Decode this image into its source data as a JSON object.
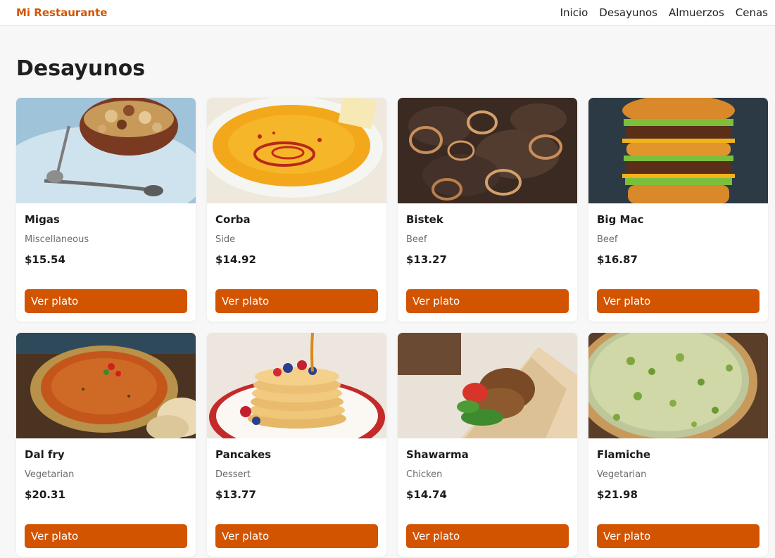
{
  "colors": {
    "accent": "#d35400",
    "background": "#f7f7f7",
    "card": "#ffffff"
  },
  "navbar": {
    "brand": "Mi Restaurante",
    "links": [
      "Inicio",
      "Desayunos",
      "Almuerzos",
      "Cenas"
    ]
  },
  "page_title": "Desayunos",
  "dishes": [
    {
      "name": "Migas",
      "category": "Miscellaneous",
      "price": "$15.54",
      "button": "Ver plato",
      "image": "migas-photo"
    },
    {
      "name": "Corba",
      "category": "Side",
      "price": "$14.92",
      "button": "Ver plato",
      "image": "corba-photo"
    },
    {
      "name": "Bistek",
      "category": "Beef",
      "price": "$13.27",
      "button": "Ver plato",
      "image": "bistek-photo"
    },
    {
      "name": "Big Mac",
      "category": "Beef",
      "price": "$16.87",
      "button": "Ver plato",
      "image": "big-mac-photo"
    },
    {
      "name": "Dal fry",
      "category": "Vegetarian",
      "price": "$20.31",
      "button": "Ver plato",
      "image": "dal-fry-photo"
    },
    {
      "name": "Pancakes",
      "category": "Dessert",
      "price": "$13.77",
      "button": "Ver plato",
      "image": "pancakes-photo"
    },
    {
      "name": "Shawarma",
      "category": "Chicken",
      "price": "$14.74",
      "button": "Ver plato",
      "image": "shawarma-photo"
    },
    {
      "name": "Flamiche",
      "category": "Vegetarian",
      "price": "$21.98",
      "button": "Ver plato",
      "image": "flamiche-photo"
    }
  ]
}
